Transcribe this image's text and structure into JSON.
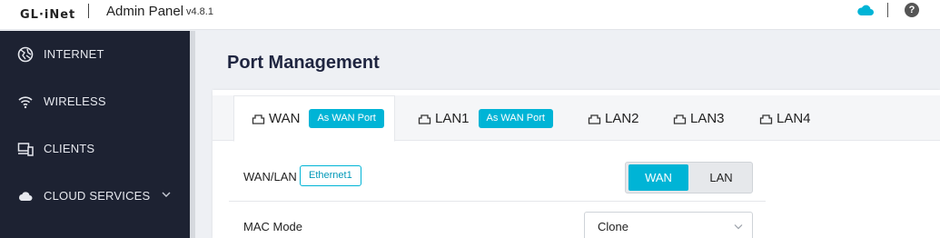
{
  "header": {
    "logo": "GL·iNet",
    "title": "Admin Panel",
    "version": "v4.8.1",
    "cloud_icon": "cloud-icon",
    "help_icon": "help-icon",
    "help_glyph": "?",
    "accent": "#00b4d6"
  },
  "sidebar": {
    "items": [
      {
        "label": "INTERNET",
        "icon": "globe-icon"
      },
      {
        "label": "WIRELESS",
        "icon": "wifi-icon"
      },
      {
        "label": "CLIENTS",
        "icon": "clients-icon"
      },
      {
        "label": "CLOUD SERVICES",
        "icon": "cloud-icon",
        "expandable": true
      }
    ]
  },
  "main": {
    "page_title": "Port Management",
    "tabs": [
      {
        "label": "WAN",
        "badge": "As WAN Port",
        "active": true
      },
      {
        "label": "LAN1",
        "badge": "As WAN Port",
        "active": false
      },
      {
        "label": "LAN2",
        "active": false
      },
      {
        "label": "LAN3",
        "active": false
      },
      {
        "label": "LAN4",
        "active": false
      }
    ],
    "wan_lan": {
      "label": "WAN/LAN",
      "interface": "Ethernet1",
      "options": [
        "WAN",
        "LAN"
      ],
      "selected": "WAN"
    },
    "mac_mode": {
      "label": "MAC Mode",
      "value": "Clone"
    }
  }
}
